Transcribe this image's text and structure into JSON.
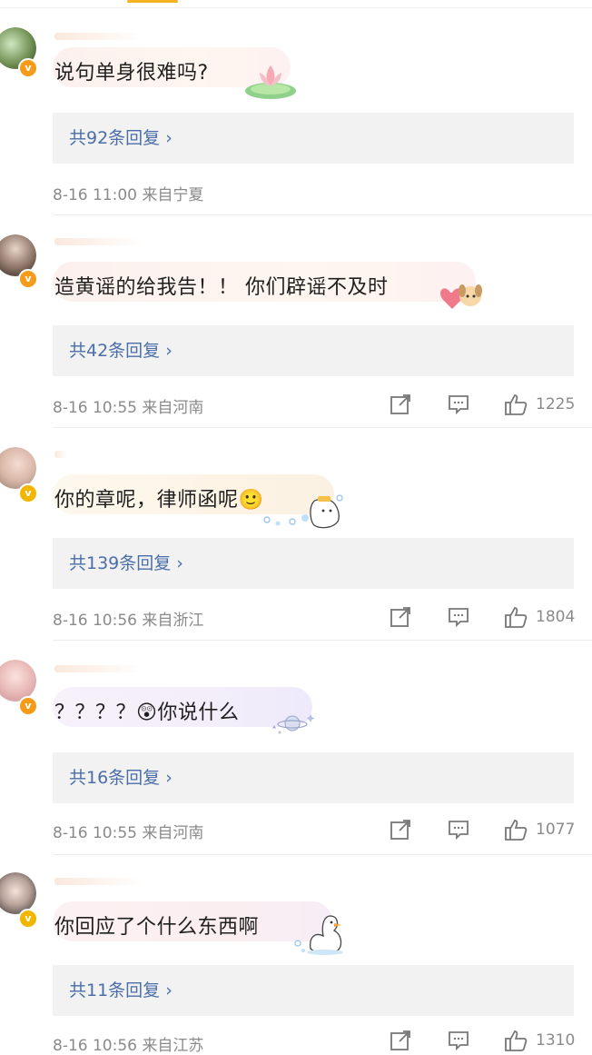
{
  "comments": [
    {
      "text": "说句单身很难吗?",
      "reply_label": "共92条回复 ›",
      "date_time": "8-16 11:00",
      "location": "来自宁夏",
      "likes": null,
      "badge_color": "#f59b1a",
      "decoration": "lotus-icon"
    },
    {
      "text": "造黄谣的给我告！！ 你们辟谣不及时",
      "reply_label": "共42条回复 ›",
      "date_time": "8-16 10:55",
      "location": "来自河南",
      "likes": "1225",
      "badge_color": "#f59b1a",
      "decoration": "puppy-heart-icon"
    },
    {
      "text": "你的章呢，律师函呢🙂",
      "reply_label": "共139条回复 ›",
      "date_time": "8-16 10:56",
      "location": "来自浙江",
      "likes": "1804",
      "badge_color": "#f2b600",
      "decoration": "bubble-ghost-icon"
    },
    {
      "text": "？？？？😲你说什么",
      "reply_label": "共16条回复 ›",
      "date_time": "8-16 10:55",
      "location": "来自河南",
      "likes": "1077",
      "badge_color": "#f59b1a",
      "decoration": "planet-icon"
    },
    {
      "text": "你回应了个什么东西啊",
      "reply_label": "共11条回复 ›",
      "date_time": "8-16 10:56",
      "location": "来自江苏",
      "likes": "1310",
      "badge_color": "#f2b600",
      "decoration": "duck-icon"
    }
  ],
  "colors": {
    "reply_link": "#4a6ea8",
    "meta_text": "#8a8a8a",
    "reply_box": "#f2f2f2",
    "verified_badge": "#f59b1a"
  }
}
